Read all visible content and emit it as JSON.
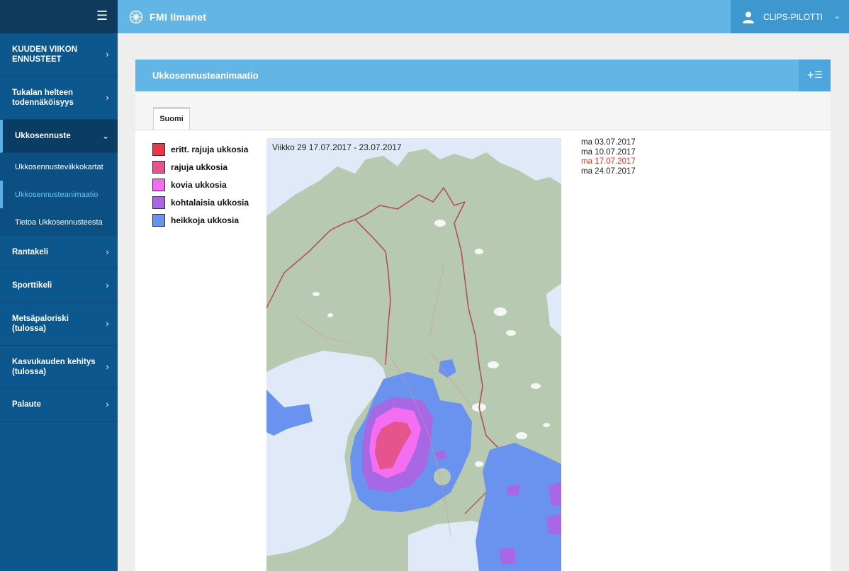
{
  "app": {
    "title": "FMI Ilmanet"
  },
  "user": {
    "name": "CLIPS-PILOTTI"
  },
  "sidebar": {
    "items": [
      {
        "label": "KUUDEN VIIKON ENNUSTEET"
      },
      {
        "label": "Tukalan helteen todennäköisyys"
      },
      {
        "label": "Ukkosennuste"
      },
      {
        "label": "Rantakeli"
      },
      {
        "label": "Sporttikeli"
      },
      {
        "label": "Metsäpaloriski (tulossa)"
      },
      {
        "label": "Kasvukauden kehitys (tulossa)"
      },
      {
        "label": "Palaute"
      }
    ],
    "subitems": [
      {
        "label": "Ukkosennusteviikkokartat"
      },
      {
        "label": "Ukkosennusteanimaatio"
      },
      {
        "label": "Tietoa Ukkosennusteesta"
      }
    ]
  },
  "panel": {
    "title": "Ukkosennusteanimaatio",
    "tool_label": "+☰",
    "tab_label": "Suomi"
  },
  "legend": [
    {
      "label": "eritt. rajuja ukkosia",
      "color": "#e8384b"
    },
    {
      "label": "rajuja ukkosia",
      "color": "#e5548d"
    },
    {
      "label": "kovia ukkosia",
      "color": "#f36ef0"
    },
    {
      "label": "kohtalaisia ukkosia",
      "color": "#a867e3"
    },
    {
      "label": "heikkoja ukkosia",
      "color": "#6a93ef"
    }
  ],
  "map": {
    "caption": "Viikko 29 17.07.2017 - 23.07.2017"
  },
  "dates": [
    {
      "label": "ma 03.07.2017"
    },
    {
      "label": "ma 10.07.2017"
    },
    {
      "label": "ma 17.07.2017",
      "active": true
    },
    {
      "label": "ma 24.07.2017"
    }
  ],
  "colors": {
    "topbar": "#63b5e6",
    "sidebar": "#0d578f",
    "active_date": "#d9352b"
  }
}
